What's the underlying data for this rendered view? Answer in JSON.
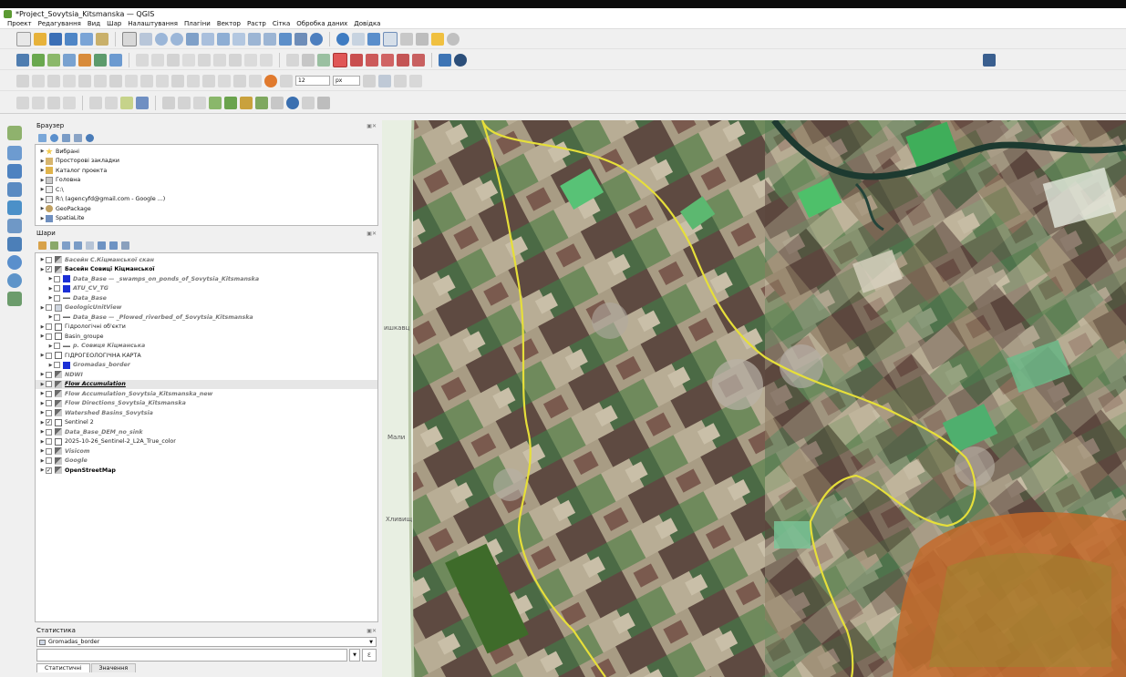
{
  "window": {
    "title": "*Project_Sovytsia_Kitsmanska — QGIS"
  },
  "menu": [
    "Проект",
    "Редагування",
    "Вид",
    "Шар",
    "Налаштування",
    "Плагіни",
    "Вектор",
    "Растр",
    "Сітка",
    "Обробка даних",
    "Довідка"
  ],
  "toolbar": {
    "scale_value": "12",
    "unit_value": "px"
  },
  "browser": {
    "title": "Браузер",
    "items": [
      {
        "label": "Вибрані",
        "icon": "star-icon"
      },
      {
        "label": "Просторові закладки",
        "icon": "bookmark-icon"
      },
      {
        "label": "Каталог проекта",
        "icon": "folder-icon"
      },
      {
        "label": "Головна",
        "icon": "home-icon"
      },
      {
        "label": "C:\\",
        "icon": "drive-icon"
      },
      {
        "label": "R:\\ (agencyfd@gmail.com - Google ...)",
        "icon": "drive-icon"
      },
      {
        "label": "GeoPackage",
        "icon": "geopackage-icon"
      },
      {
        "label": "SpatiaLite",
        "icon": "spatialite-icon"
      }
    ]
  },
  "layers": {
    "title": "Шари",
    "items": [
      {
        "label": "Басейн С.Кіцманської скан",
        "style": "it",
        "icon": "raster-icon",
        "checked": false,
        "indent": 0
      },
      {
        "label": "Басейн Совиці Кіцманської",
        "style": "bd",
        "icon": "raster-icon",
        "checked": true,
        "indent": 0
      },
      {
        "label": "Data_Base — _swamps_on_ponds_of_Sovytsia_Kitsmanska",
        "style": "it",
        "icon": "blue-fill-icon",
        "checked": false,
        "indent": 1
      },
      {
        "label": "ATU_CV_TG",
        "style": "it",
        "icon": "blue-fill-icon",
        "checked": false,
        "indent": 1
      },
      {
        "label": "Data_Base",
        "style": "it",
        "icon": "line-icon",
        "checked": false,
        "indent": 1
      },
      {
        "label": "GeologicUnitView",
        "style": "it",
        "icon": "polygon-icon",
        "checked": false,
        "indent": 0
      },
      {
        "label": "Data_Base — _Plowed_riverbed_of_Sovytsia_Kitsmanska",
        "style": "it",
        "icon": "line-icon",
        "checked": false,
        "indent": 1
      },
      {
        "label": "Гідрологічні об'єкти",
        "style": "nm",
        "icon": "group-icon",
        "checked": false,
        "indent": 0
      },
      {
        "label": "Basin_groupe",
        "style": "nm",
        "icon": "group-icon",
        "checked": false,
        "indent": 0
      },
      {
        "label": "р. Совиця Кіцманська",
        "style": "it",
        "icon": "line-icon",
        "checked": false,
        "indent": 1
      },
      {
        "label": "ГІДРОГЕОЛОГІЧНА КАРТА",
        "style": "nm",
        "icon": "group-icon",
        "checked": false,
        "indent": 0
      },
      {
        "label": "Gromadas_border",
        "style": "it",
        "icon": "blue-fill-icon",
        "checked": false,
        "indent": 1
      },
      {
        "label": "NDWI",
        "style": "it",
        "icon": "raster-icon",
        "checked": false,
        "indent": 0
      },
      {
        "label": "Flow Accumulation",
        "style": "bdu",
        "icon": "raster-icon",
        "checked": false,
        "indent": 0
      },
      {
        "label": "Flow Accumulation_Sovytsia_Kitsmanska_new",
        "style": "it",
        "icon": "raster-icon",
        "checked": false,
        "indent": 0
      },
      {
        "label": "Flow Directions_Sovytsia_Kitsmanska",
        "style": "it",
        "icon": "raster-icon",
        "checked": false,
        "indent": 0
      },
      {
        "label": "Watershed Basins_Sovytsia",
        "style": "it",
        "icon": "raster-icon",
        "checked": false,
        "indent": 0
      },
      {
        "label": "Sentinel 2",
        "style": "nm",
        "icon": "group-icon",
        "checked": true,
        "indent": 0
      },
      {
        "label": "Data_Base_DEM_no_sink",
        "style": "it",
        "icon": "raster-icon",
        "checked": false,
        "indent": 0
      },
      {
        "label": "2025-10-26_Sentinel-2_L2A_True_color",
        "style": "nm",
        "icon": "group-icon",
        "checked": false,
        "indent": 0
      },
      {
        "label": "Visicom",
        "style": "it",
        "icon": "raster-icon",
        "checked": false,
        "indent": 0
      },
      {
        "label": "Google",
        "style": "it",
        "icon": "raster-icon",
        "checked": false,
        "indent": 0
      },
      {
        "label": "OpenStreetMap",
        "style": "bd",
        "icon": "raster-icon",
        "checked": true,
        "indent": 0
      }
    ]
  },
  "statistics": {
    "title": "Статистика",
    "layer": "Gromadas_border",
    "tabs": [
      "Статистичні",
      "Значення"
    ]
  },
  "map": {
    "labels": [
      "ишкавц",
      "Мали",
      "Хливищ"
    ],
    "basin_color": "#e6df3a"
  }
}
